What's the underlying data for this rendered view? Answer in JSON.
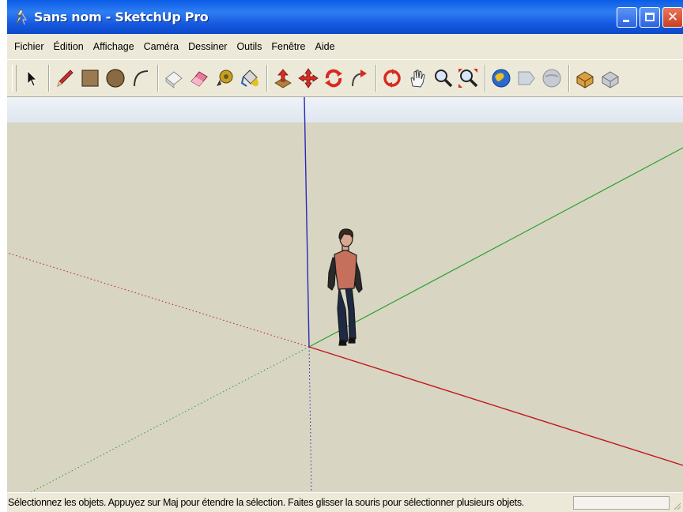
{
  "window": {
    "title": "Sans nom - SketchUp Pro",
    "app_icon": "sketchup-logo-icon",
    "controls": {
      "minimize": "minimize-icon",
      "maximize": "maximize-icon",
      "close": "close-icon"
    }
  },
  "menubar": {
    "items": [
      {
        "label": "Fichier"
      },
      {
        "label": "Édition"
      },
      {
        "label": "Affichage"
      },
      {
        "label": "Caméra"
      },
      {
        "label": "Dessiner"
      },
      {
        "label": "Outils"
      },
      {
        "label": "Fenêtre"
      },
      {
        "label": "Aide"
      }
    ]
  },
  "toolbar": {
    "tools": [
      "select-icon",
      "pencil-icon",
      "rectangle-icon",
      "circle-icon",
      "arc-icon",
      "make-component-icon",
      "eraser-icon",
      "tape-measure-icon",
      "paint-bucket-icon",
      "push-pull-icon",
      "move-icon",
      "rotate-icon",
      "follow-me-icon",
      "orbit-icon",
      "pan-icon",
      "zoom-icon",
      "zoom-extents-icon",
      "get-models-icon",
      "share-model-icon",
      "google-earth-icon",
      "components-icon",
      "styles-icon"
    ]
  },
  "viewport": {
    "axis_colors": {
      "red": "#c0181a",
      "green": "#2aa12a",
      "blue": "#2a2ab8"
    },
    "figure": "person-figure"
  },
  "statusbar": {
    "text": "Sélectionnez les objets. Appuyez sur Maj pour étendre la sélection. Faites glisser la souris pour sélectionner plusieurs objets.",
    "measurements_value": ""
  }
}
